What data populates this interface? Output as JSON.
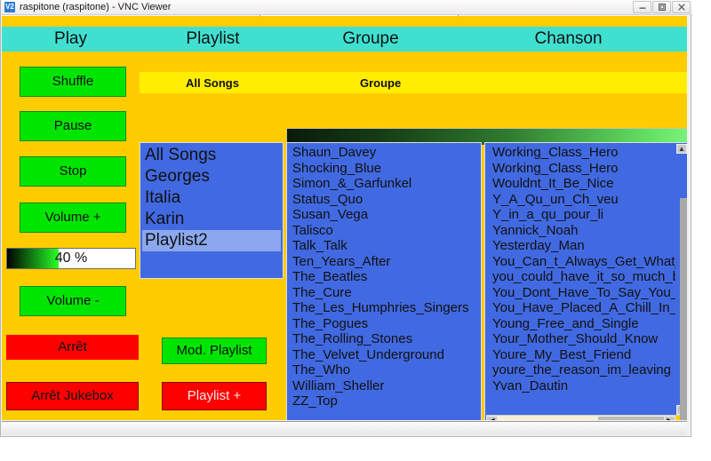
{
  "window": {
    "title": "raspitone (raspitone) - VNC Viewer",
    "logo_text": "V2",
    "controls": {
      "minimize": "minimize-icon",
      "maximize": "maximize-icon",
      "close": "close-icon"
    }
  },
  "tabs": [
    {
      "label": "Play"
    },
    {
      "label": "Playlist"
    },
    {
      "label": "Groupe"
    },
    {
      "label": "Chanson"
    }
  ],
  "controls": {
    "shuffle": "Shuffle",
    "pause": "Pause",
    "stop": "Stop",
    "volume_up": "Volume +",
    "volume_down": "Volume -",
    "arret": "Arrêt",
    "arret_jukebox": "Arrêt Jukebox",
    "mod_playlist": "Mod. Playlist",
    "playlist_plus": "Playlist +"
  },
  "volume": {
    "label": "40 %",
    "percent": 40
  },
  "status_strip": {
    "all_songs": "All Songs",
    "groupe": "Groupe"
  },
  "progress": {
    "percent": 100
  },
  "playlists": {
    "selected": "Playlist2",
    "items": [
      "All Songs",
      "Georges",
      "Italia",
      "Karin",
      "Playlist2"
    ]
  },
  "groups": {
    "items": [
      "Shaun_Davey",
      "Shocking_Blue",
      "Simon_&_Garfunkel",
      "Status_Quo",
      "Susan_Vega",
      "Talisco",
      "Talk_Talk",
      "Ten_Years_After",
      "The_Beatles",
      "The_Cure",
      "The_Les_Humphries_Singers",
      "The_Pogues",
      "The_Rolling_Stones",
      "The_Velvet_Underground",
      "The_Who",
      "William_Sheller",
      "ZZ_Top"
    ]
  },
  "songs": {
    "items": [
      "Working_Class_Hero",
      "Working_Class_Hero",
      "Wouldnt_It_Be_Nice",
      "Y_A_Qu_un_Ch_veu",
      "Y_in_a_qu_pour_li",
      "Yannick_Noah",
      "Yesterday_Man",
      "You_Can_t_Always_Get_What_",
      "you_could_have_it_so_much_be",
      "You_Dont_Have_To_Say_You_L",
      "You_Have_Placed_A_Chill_In_M",
      "Young_Free_and_Single",
      "Your_Mother_Should_Know",
      "Youre_My_Best_Friend",
      "youre_the_reason_im_leaving",
      "Yvan_Dautin"
    ],
    "scroll": {
      "up_arrow": "▲",
      "down_arrow": "▼",
      "left_arrow": "◀",
      "right_arrow": "▶"
    }
  },
  "colors": {
    "app_background": "#ffcc00",
    "tabbar": "#40e0d0",
    "list_background": "#4169e1",
    "button_green": "#00e500",
    "button_red": "#ff0000",
    "status_strip": "#ffee00"
  }
}
